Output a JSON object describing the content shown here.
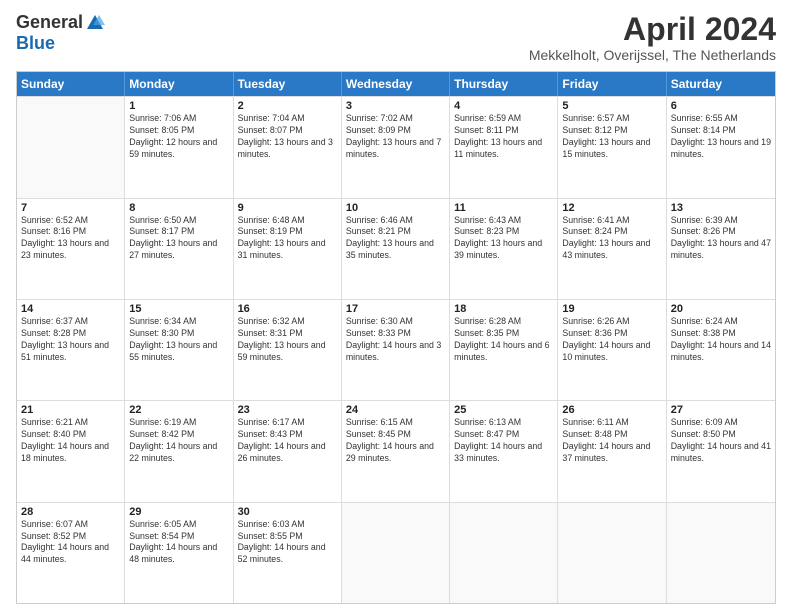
{
  "logo": {
    "general": "General",
    "blue": "Blue"
  },
  "title": "April 2024",
  "location": "Mekkelholt, Overijssel, The Netherlands",
  "weekdays": [
    "Sunday",
    "Monday",
    "Tuesday",
    "Wednesday",
    "Thursday",
    "Friday",
    "Saturday"
  ],
  "weeks": [
    [
      {
        "day": "",
        "sunrise": "",
        "sunset": "",
        "daylight": ""
      },
      {
        "day": "1",
        "sunrise": "Sunrise: 7:06 AM",
        "sunset": "Sunset: 8:05 PM",
        "daylight": "Daylight: 12 hours and 59 minutes."
      },
      {
        "day": "2",
        "sunrise": "Sunrise: 7:04 AM",
        "sunset": "Sunset: 8:07 PM",
        "daylight": "Daylight: 13 hours and 3 minutes."
      },
      {
        "day": "3",
        "sunrise": "Sunrise: 7:02 AM",
        "sunset": "Sunset: 8:09 PM",
        "daylight": "Daylight: 13 hours and 7 minutes."
      },
      {
        "day": "4",
        "sunrise": "Sunrise: 6:59 AM",
        "sunset": "Sunset: 8:11 PM",
        "daylight": "Daylight: 13 hours and 11 minutes."
      },
      {
        "day": "5",
        "sunrise": "Sunrise: 6:57 AM",
        "sunset": "Sunset: 8:12 PM",
        "daylight": "Daylight: 13 hours and 15 minutes."
      },
      {
        "day": "6",
        "sunrise": "Sunrise: 6:55 AM",
        "sunset": "Sunset: 8:14 PM",
        "daylight": "Daylight: 13 hours and 19 minutes."
      }
    ],
    [
      {
        "day": "7",
        "sunrise": "Sunrise: 6:52 AM",
        "sunset": "Sunset: 8:16 PM",
        "daylight": "Daylight: 13 hours and 23 minutes."
      },
      {
        "day": "8",
        "sunrise": "Sunrise: 6:50 AM",
        "sunset": "Sunset: 8:17 PM",
        "daylight": "Daylight: 13 hours and 27 minutes."
      },
      {
        "day": "9",
        "sunrise": "Sunrise: 6:48 AM",
        "sunset": "Sunset: 8:19 PM",
        "daylight": "Daylight: 13 hours and 31 minutes."
      },
      {
        "day": "10",
        "sunrise": "Sunrise: 6:46 AM",
        "sunset": "Sunset: 8:21 PM",
        "daylight": "Daylight: 13 hours and 35 minutes."
      },
      {
        "day": "11",
        "sunrise": "Sunrise: 6:43 AM",
        "sunset": "Sunset: 8:23 PM",
        "daylight": "Daylight: 13 hours and 39 minutes."
      },
      {
        "day": "12",
        "sunrise": "Sunrise: 6:41 AM",
        "sunset": "Sunset: 8:24 PM",
        "daylight": "Daylight: 13 hours and 43 minutes."
      },
      {
        "day": "13",
        "sunrise": "Sunrise: 6:39 AM",
        "sunset": "Sunset: 8:26 PM",
        "daylight": "Daylight: 13 hours and 47 minutes."
      }
    ],
    [
      {
        "day": "14",
        "sunrise": "Sunrise: 6:37 AM",
        "sunset": "Sunset: 8:28 PM",
        "daylight": "Daylight: 13 hours and 51 minutes."
      },
      {
        "day": "15",
        "sunrise": "Sunrise: 6:34 AM",
        "sunset": "Sunset: 8:30 PM",
        "daylight": "Daylight: 13 hours and 55 minutes."
      },
      {
        "day": "16",
        "sunrise": "Sunrise: 6:32 AM",
        "sunset": "Sunset: 8:31 PM",
        "daylight": "Daylight: 13 hours and 59 minutes."
      },
      {
        "day": "17",
        "sunrise": "Sunrise: 6:30 AM",
        "sunset": "Sunset: 8:33 PM",
        "daylight": "Daylight: 14 hours and 3 minutes."
      },
      {
        "day": "18",
        "sunrise": "Sunrise: 6:28 AM",
        "sunset": "Sunset: 8:35 PM",
        "daylight": "Daylight: 14 hours and 6 minutes."
      },
      {
        "day": "19",
        "sunrise": "Sunrise: 6:26 AM",
        "sunset": "Sunset: 8:36 PM",
        "daylight": "Daylight: 14 hours and 10 minutes."
      },
      {
        "day": "20",
        "sunrise": "Sunrise: 6:24 AM",
        "sunset": "Sunset: 8:38 PM",
        "daylight": "Daylight: 14 hours and 14 minutes."
      }
    ],
    [
      {
        "day": "21",
        "sunrise": "Sunrise: 6:21 AM",
        "sunset": "Sunset: 8:40 PM",
        "daylight": "Daylight: 14 hours and 18 minutes."
      },
      {
        "day": "22",
        "sunrise": "Sunrise: 6:19 AM",
        "sunset": "Sunset: 8:42 PM",
        "daylight": "Daylight: 14 hours and 22 minutes."
      },
      {
        "day": "23",
        "sunrise": "Sunrise: 6:17 AM",
        "sunset": "Sunset: 8:43 PM",
        "daylight": "Daylight: 14 hours and 26 minutes."
      },
      {
        "day": "24",
        "sunrise": "Sunrise: 6:15 AM",
        "sunset": "Sunset: 8:45 PM",
        "daylight": "Daylight: 14 hours and 29 minutes."
      },
      {
        "day": "25",
        "sunrise": "Sunrise: 6:13 AM",
        "sunset": "Sunset: 8:47 PM",
        "daylight": "Daylight: 14 hours and 33 minutes."
      },
      {
        "day": "26",
        "sunrise": "Sunrise: 6:11 AM",
        "sunset": "Sunset: 8:48 PM",
        "daylight": "Daylight: 14 hours and 37 minutes."
      },
      {
        "day": "27",
        "sunrise": "Sunrise: 6:09 AM",
        "sunset": "Sunset: 8:50 PM",
        "daylight": "Daylight: 14 hours and 41 minutes."
      }
    ],
    [
      {
        "day": "28",
        "sunrise": "Sunrise: 6:07 AM",
        "sunset": "Sunset: 8:52 PM",
        "daylight": "Daylight: 14 hours and 44 minutes."
      },
      {
        "day": "29",
        "sunrise": "Sunrise: 6:05 AM",
        "sunset": "Sunset: 8:54 PM",
        "daylight": "Daylight: 14 hours and 48 minutes."
      },
      {
        "day": "30",
        "sunrise": "Sunrise: 6:03 AM",
        "sunset": "Sunset: 8:55 PM",
        "daylight": "Daylight: 14 hours and 52 minutes."
      },
      {
        "day": "",
        "sunrise": "",
        "sunset": "",
        "daylight": ""
      },
      {
        "day": "",
        "sunrise": "",
        "sunset": "",
        "daylight": ""
      },
      {
        "day": "",
        "sunrise": "",
        "sunset": "",
        "daylight": ""
      },
      {
        "day": "",
        "sunrise": "",
        "sunset": "",
        "daylight": ""
      }
    ]
  ]
}
